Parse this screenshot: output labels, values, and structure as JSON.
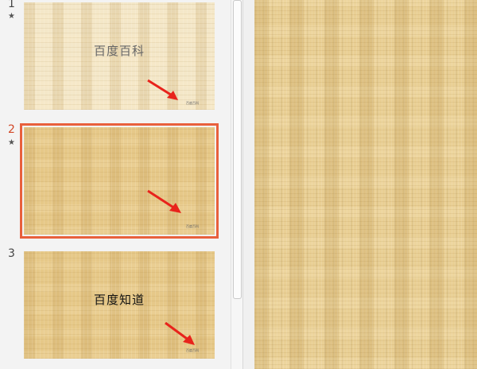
{
  "thumbnails": [
    {
      "number": "1",
      "has_star": true,
      "title": "百度百科",
      "footer": "百度百科",
      "selected": false
    },
    {
      "number": "2",
      "has_star": true,
      "title": "",
      "footer": "百度百科",
      "selected": true
    },
    {
      "number": "3",
      "has_star": false,
      "title": "百度知道",
      "footer": "百度百科",
      "selected": false
    }
  ],
  "icons": {
    "star": "star-icon",
    "arrow": "red-arrow-annotation"
  },
  "colors": {
    "selection_border": "#e8603c",
    "active_number": "#d24726",
    "arrow": "#e8231c",
    "texture_base": "#e6c888"
  }
}
